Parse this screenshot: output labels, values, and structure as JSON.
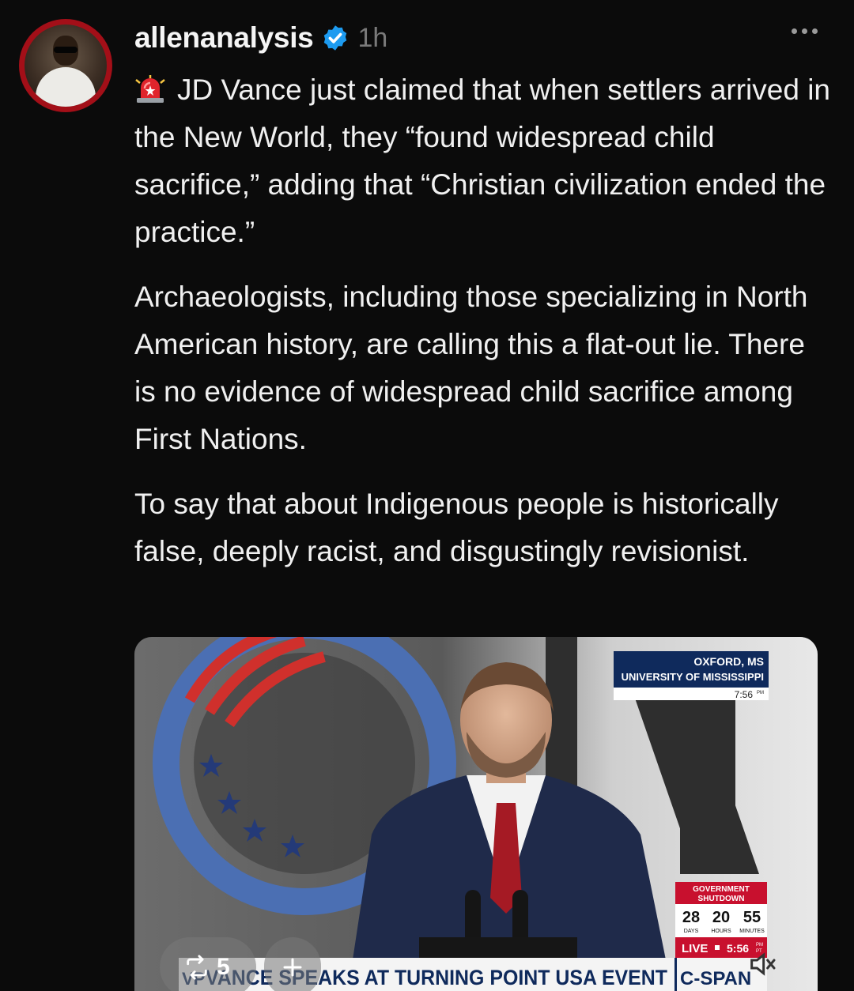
{
  "post": {
    "username": "allenanalysis",
    "time": "1h",
    "paragraphs": [
      "JD Vance just claimed that when settlers arrived in the New World, they “found widespread child sacrifice,” adding that “Christian civilization ended the practice.”",
      "Archaeologists, including those specializing in North American history, are calling this a flat-out lie. There is no evidence of widespread child sacrifice among First Nations.",
      "To say that about Indigenous people is historically false, deeply racist, and disgustingly revisionist."
    ],
    "lead_icon": "siren-icon",
    "verified_icon": "verified-badge-icon"
  },
  "video": {
    "location_line1": "OXFORD, MS",
    "location_line2": "UNIVERSITY OF MISSISSIPPI",
    "location_time": "7:56",
    "location_time_suffix": "PM",
    "shutdown_label_1": "GOVERNMENT",
    "shutdown_label_2": "SHUTDOWN",
    "days": "28",
    "hours": "20",
    "minutes": "55",
    "days_label": "DAYS",
    "hours_label": "HOURS",
    "minutes_label": "MINUTES",
    "live_label": "LIVE",
    "live_time": "5:56",
    "live_time_suffix_1": "PM",
    "live_time_suffix_2": "PT",
    "chyron_prefix": "VP",
    "chyron": "VANCE SPEAKS AT TURNING POINT USA EVENT",
    "network": "C-SPAN"
  },
  "actions": {
    "repost_count": "5"
  },
  "colors": {
    "background": "#0b0b0b",
    "verified": "#1d9bf0",
    "cspan_red": "#c8102e",
    "chyron_navy": "#0f2a5c"
  }
}
